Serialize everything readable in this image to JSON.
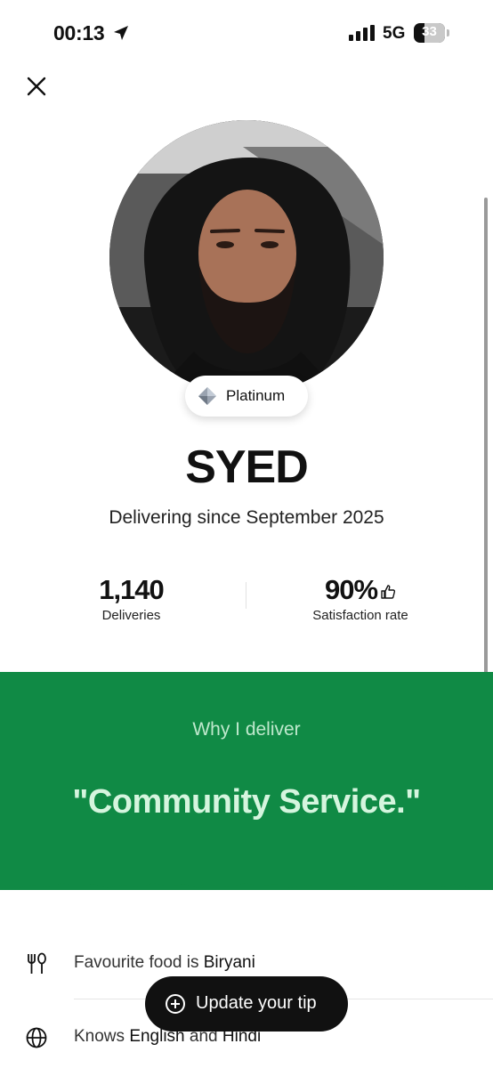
{
  "status_bar": {
    "time": "00:13",
    "network": "5G",
    "battery": "33"
  },
  "profile": {
    "tier": "Platinum",
    "name": "SYED",
    "since": "Delivering since September 2025"
  },
  "stats": {
    "deliveries_value": "1,140",
    "deliveries_label": "Deliveries",
    "satisfaction_value": "90%",
    "satisfaction_label": "Satisfaction rate"
  },
  "why": {
    "label": "Why I deliver",
    "quote": "\"Community Service.\""
  },
  "details": {
    "food_prefix": "Favourite food is ",
    "food_value": "Biryani",
    "lang_prefix": "Knows ",
    "lang_1": "English",
    "lang_and": " and ",
    "lang_2": "Hindi"
  },
  "tip_button": {
    "label": "Update your tip"
  },
  "colors": {
    "banner_green": "#108a45",
    "quote_text": "#d5f5de"
  },
  "icons": {
    "close": "close-icon",
    "location": "location-arrow-icon",
    "signal": "signal-bars-icon",
    "tier": "diamond-icon",
    "thumb": "thumbs-up-icon",
    "food": "fork-knife-icon",
    "language": "globe-icon",
    "tip": "plus-circle-icon"
  }
}
